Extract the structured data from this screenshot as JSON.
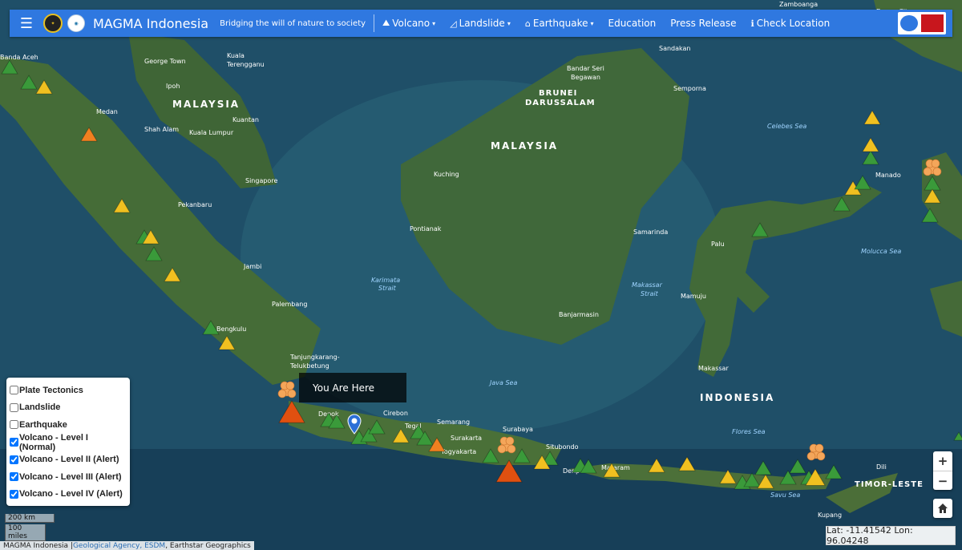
{
  "header": {
    "brand": "MAGMA Indonesia",
    "tagline": "Bridging the will of nature to society",
    "nav": [
      {
        "label": "Volcano",
        "icon": "volcano-icon",
        "dropdown": true
      },
      {
        "label": "Landslide",
        "icon": "landslide-icon",
        "dropdown": true
      },
      {
        "label": "Earthquake",
        "icon": "earthquake-icon",
        "dropdown": true
      },
      {
        "label": "Education",
        "dropdown": false
      },
      {
        "label": "Press Release",
        "dropdown": false
      },
      {
        "label": "Check Location",
        "icon": "info-icon",
        "dropdown": false
      }
    ],
    "accent_color": "#2f78e0"
  },
  "map_labels": {
    "countries": [
      "MALAYSIA",
      "MALAYSIA",
      "BRUNEI DARUSSALAM",
      "INDONESIA",
      "TIMOR-LESTE"
    ],
    "cities": [
      "Banda Aceh",
      "George Town",
      "Kuala Terengganu",
      "Ipoh",
      "Medan",
      "Shah Alam",
      "Kuala Lumpur",
      "Kuantan",
      "Singapore",
      "Pekanbaru",
      "Jambi",
      "Palembang",
      "Bengkulu",
      "Tanjungkarang-Telukbetung",
      "Depok",
      "Cirebon",
      "Tegal",
      "Semarang",
      "Surakarta",
      "Yogyakarta",
      "Surabaya",
      "Situbondo",
      "Denpasar",
      "Mataram",
      "Kuching",
      "Pontianak",
      "Banjarmasin",
      "Samarinda",
      "Palu",
      "Mamuju",
      "Makassar",
      "Manado",
      "Sandakan",
      "Semporna",
      "Bandar Seri Begawan",
      "Kupang",
      "Dili",
      "Zamboanga City",
      "Davao City"
    ],
    "seas": [
      "Celebes Sea",
      "Molucca Sea",
      "Makassar Strait",
      "Karimata Strait",
      "Java Sea",
      "Flores Sea",
      "Savu Sea"
    ]
  },
  "volcano_markers": {
    "level_colors": {
      "normal": "#3a9a3a",
      "alert": "#f0c020",
      "standby": "#f08020",
      "warning": "#e05010"
    },
    "eruption_icon": "eruption-cloud-icon"
  },
  "legend": {
    "items": [
      {
        "label": "Plate Tectonics",
        "checked": false
      },
      {
        "label": "Landslide",
        "checked": false
      },
      {
        "label": "Earthquake",
        "checked": false
      },
      {
        "label": "Volcano - Level I (Normal)",
        "checked": true
      },
      {
        "label": "Volcano - Level II (Alert)",
        "checked": true
      },
      {
        "label": "Volcano - Level III (Alert)",
        "checked": true
      },
      {
        "label": "Volcano - Level IV (Alert)",
        "checked": true
      }
    ]
  },
  "tooltip": {
    "text": "You Are Here"
  },
  "zoom": {
    "in": "+",
    "out": "−"
  },
  "scale": {
    "km": "200 km",
    "miles": "100 miles"
  },
  "attribution": {
    "prefix": "MAGMA Indonesia | ",
    "link": "Geological Agency, ESDM",
    "suffix": ", Earthstar Geographics"
  },
  "coordinates": "Lat: -11.41542  Lon: 96.04248"
}
